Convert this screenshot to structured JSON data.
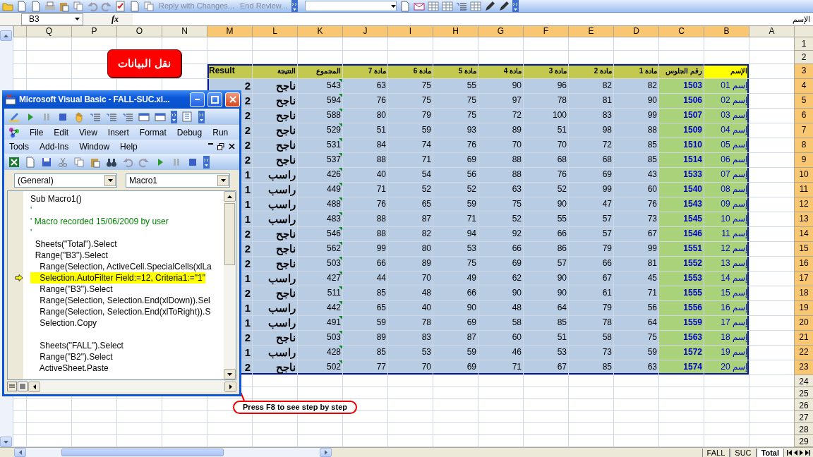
{
  "excel_toolbar": {
    "review_buttons": [
      {
        "label": "End Review...",
        "disabled": true
      },
      {
        "label": "Reply with Changes...",
        "disabled": true
      }
    ]
  },
  "formula_bar": {
    "name_box": "B3",
    "function_label": "fx",
    "content": "الإسم"
  },
  "sheet": {
    "columns": [
      {
        "label": "A",
        "selected": false
      },
      {
        "label": "B",
        "selected": true
      },
      {
        "label": "C",
        "selected": true
      },
      {
        "label": "D",
        "selected": true
      },
      {
        "label": "E",
        "selected": true
      },
      {
        "label": "F",
        "selected": true
      },
      {
        "label": "G",
        "selected": true
      },
      {
        "label": "H",
        "selected": true
      },
      {
        "label": "I",
        "selected": true
      },
      {
        "label": "J",
        "selected": true
      },
      {
        "label": "K",
        "selected": true
      },
      {
        "label": "L",
        "selected": true
      },
      {
        "label": "M",
        "selected": true
      },
      {
        "label": "N",
        "selected": false
      },
      {
        "label": "O",
        "selected": false
      },
      {
        "label": "P",
        "selected": false
      },
      {
        "label": "Q",
        "selected": false
      }
    ],
    "rows": [
      {
        "label": "1",
        "selected": false
      },
      {
        "label": "2",
        "selected": false
      },
      {
        "label": "3",
        "selected": true
      },
      {
        "label": "4",
        "selected": true
      },
      {
        "label": "5",
        "selected": true
      },
      {
        "label": "6",
        "selected": true
      },
      {
        "label": "7",
        "selected": true
      },
      {
        "label": "8",
        "selected": true
      },
      {
        "label": "9",
        "selected": true
      },
      {
        "label": "10",
        "selected": true
      },
      {
        "label": "11",
        "selected": true
      },
      {
        "label": "12",
        "selected": true
      },
      {
        "label": "13",
        "selected": true
      },
      {
        "label": "14",
        "selected": true
      },
      {
        "label": "15",
        "selected": true
      },
      {
        "label": "16",
        "selected": true
      },
      {
        "label": "17",
        "selected": true
      },
      {
        "label": "18",
        "selected": true
      },
      {
        "label": "19",
        "selected": true
      },
      {
        "label": "20",
        "selected": true
      },
      {
        "label": "21",
        "selected": true
      },
      {
        "label": "22",
        "selected": true
      },
      {
        "label": "23",
        "selected": true
      },
      {
        "label": "24",
        "selected": false
      },
      {
        "label": "25",
        "selected": false
      },
      {
        "label": "26",
        "selected": false
      },
      {
        "label": "27",
        "selected": false
      },
      {
        "label": "28",
        "selected": false
      },
      {
        "label": "29",
        "selected": false
      }
    ]
  },
  "table": {
    "header": [
      "الإسم",
      "رقم الجلوس",
      "مادة 1",
      "مادة 2",
      "مادة 3",
      "مادة 4",
      "مادة 5",
      "مادة 6",
      "مادة 7",
      "المجموع",
      "التتيجة",
      "Result"
    ],
    "rows": [
      {
        "name": "إسم 01",
        "seat": "1503",
        "marks": [
          "82",
          "82",
          "96",
          "90",
          "55",
          "75",
          "63"
        ],
        "total": "543",
        "result": "ناجح",
        "code": "2"
      },
      {
        "name": "إسم 02",
        "seat": "1506",
        "marks": [
          "90",
          "81",
          "78",
          "97",
          "75",
          "75",
          "76"
        ],
        "total": "594",
        "result": "ناجح",
        "code": "2"
      },
      {
        "name": "إسم 03",
        "seat": "1507",
        "marks": [
          "99",
          "83",
          "100",
          "72",
          "75",
          "79",
          "80"
        ],
        "total": "588",
        "result": "ناجح",
        "code": "2"
      },
      {
        "name": "إسم 04",
        "seat": "1509",
        "marks": [
          "88",
          "98",
          "51",
          "89",
          "93",
          "59",
          "51"
        ],
        "total": "529",
        "result": "ناجح",
        "code": "2"
      },
      {
        "name": "إسم 05",
        "seat": "1510",
        "marks": [
          "85",
          "72",
          "70",
          "70",
          "76",
          "74",
          "84"
        ],
        "total": "531",
        "result": "ناجح",
        "code": "2"
      },
      {
        "name": "إسم 06",
        "seat": "1514",
        "marks": [
          "85",
          "68",
          "68",
          "88",
          "69",
          "71",
          "88"
        ],
        "total": "537",
        "result": "ناجح",
        "code": "2"
      },
      {
        "name": "إسم 07",
        "seat": "1533",
        "marks": [
          "43",
          "69",
          "76",
          "88",
          "56",
          "54",
          "40"
        ],
        "total": "426",
        "result": "راسب",
        "code": "1"
      },
      {
        "name": "إسم 08",
        "seat": "1540",
        "marks": [
          "60",
          "99",
          "52",
          "63",
          "52",
          "52",
          "71"
        ],
        "total": "449",
        "result": "راسب",
        "code": "1"
      },
      {
        "name": "إسم 09",
        "seat": "1543",
        "marks": [
          "76",
          "47",
          "90",
          "75",
          "59",
          "65",
          "76"
        ],
        "total": "488",
        "result": "راسب",
        "code": "1"
      },
      {
        "name": "إسم 10",
        "seat": "1545",
        "marks": [
          "73",
          "57",
          "55",
          "52",
          "71",
          "87",
          "88"
        ],
        "total": "483",
        "result": "راسب",
        "code": "1"
      },
      {
        "name": "إسم 11",
        "seat": "1546",
        "marks": [
          "67",
          "57",
          "66",
          "92",
          "94",
          "82",
          "88"
        ],
        "total": "546",
        "result": "ناجح",
        "code": "2"
      },
      {
        "name": "إسم 12",
        "seat": "1551",
        "marks": [
          "99",
          "79",
          "86",
          "66",
          "53",
          "80",
          "99"
        ],
        "total": "562",
        "result": "ناجح",
        "code": "2"
      },
      {
        "name": "إسم 13",
        "seat": "1552",
        "marks": [
          "81",
          "66",
          "57",
          "69",
          "75",
          "89",
          "66"
        ],
        "total": "503",
        "result": "ناجح",
        "code": "2"
      },
      {
        "name": "إسم 14",
        "seat": "1553",
        "marks": [
          "45",
          "67",
          "90",
          "62",
          "49",
          "70",
          "44"
        ],
        "total": "427",
        "result": "راسب",
        "code": "1"
      },
      {
        "name": "إسم 15",
        "seat": "1555",
        "marks": [
          "71",
          "61",
          "90",
          "90",
          "66",
          "48",
          "85"
        ],
        "total": "511",
        "result": "ناجح",
        "code": "2"
      },
      {
        "name": "إسم 16",
        "seat": "1556",
        "marks": [
          "56",
          "79",
          "64",
          "48",
          "90",
          "40",
          "65"
        ],
        "total": "442",
        "result": "راسب",
        "code": "1"
      },
      {
        "name": "إسم 17",
        "seat": "1559",
        "marks": [
          "64",
          "78",
          "85",
          "58",
          "69",
          "78",
          "59"
        ],
        "total": "491",
        "result": "راسب",
        "code": "1"
      },
      {
        "name": "إسم 18",
        "seat": "1563",
        "marks": [
          "75",
          "58",
          "51",
          "60",
          "87",
          "83",
          "89"
        ],
        "total": "503",
        "result": "ناجح",
        "code": "2"
      },
      {
        "name": "إسم 19",
        "seat": "1572",
        "marks": [
          "59",
          "73",
          "53",
          "46",
          "59",
          "53",
          "85"
        ],
        "total": "428",
        "result": "راسب",
        "code": "1"
      },
      {
        "name": "إسم 20",
        "seat": "1574",
        "marks": [
          "63",
          "85",
          "67",
          "71",
          "69",
          "70",
          "77"
        ],
        "total": "502",
        "result": "ناجح",
        "code": "2"
      }
    ]
  },
  "macro_button": {
    "label": "نقل البيانات"
  },
  "callout": {
    "text": "Press F8 to see step by step"
  },
  "vba_window": {
    "title": "Microsoft Visual Basic - FALL-SUC.xl...",
    "menu_rows": [
      [
        "Run",
        "Debug",
        "Format",
        "Insert",
        "View",
        "Edit",
        "File"
      ],
      [
        "Help",
        "Window",
        "Add-Ins",
        "Tools"
      ]
    ],
    "object_box": "(General)",
    "procedure_box": "Macro1",
    "code": [
      {
        "kind": "code",
        "text": "Sub Macro1()",
        "current": false
      },
      {
        "kind": "comment",
        "text": "'",
        "current": false
      },
      {
        "kind": "comment",
        "text": "' Macro recorded 15/06/2009 by user",
        "current": false
      },
      {
        "kind": "comment",
        "text": "'",
        "current": false
      },
      {
        "kind": "code",
        "text": "  Sheets(\"Total\").Select",
        "current": false
      },
      {
        "kind": "code",
        "text": "  Range(\"B3\").Select",
        "current": false
      },
      {
        "kind": "code",
        "text": "    Range(Selection, ActiveCell.SpecialCells(xlLa",
        "current": false
      },
      {
        "kind": "code",
        "text": "    Selection.AutoFilter Field:=12, Criteria1:=\"1\"",
        "current": true
      },
      {
        "kind": "code",
        "text": "    Range(\"B3\").Select",
        "current": false
      },
      {
        "kind": "code",
        "text": "    Range(Selection, Selection.End(xlDown)).Sel",
        "current": false
      },
      {
        "kind": "code",
        "text": "    Range(Selection, Selection.End(xlToRight)).S",
        "current": false
      },
      {
        "kind": "code",
        "text": "    Selection.Copy",
        "current": false
      },
      {
        "kind": "blank",
        "current": false
      },
      {
        "kind": "code",
        "text": "    Sheets(\"FALL\").Select",
        "current": false
      },
      {
        "kind": "code",
        "text": "    Range(\"B2\").Select",
        "current": false
      },
      {
        "kind": "code",
        "text": "    ActiveSheet.Paste",
        "current": false
      }
    ]
  },
  "sheet_tabs": [
    {
      "label": "Total",
      "selected": true
    },
    {
      "label": "SUC",
      "selected": false
    },
    {
      "label": "FALL",
      "selected": false
    }
  ]
}
